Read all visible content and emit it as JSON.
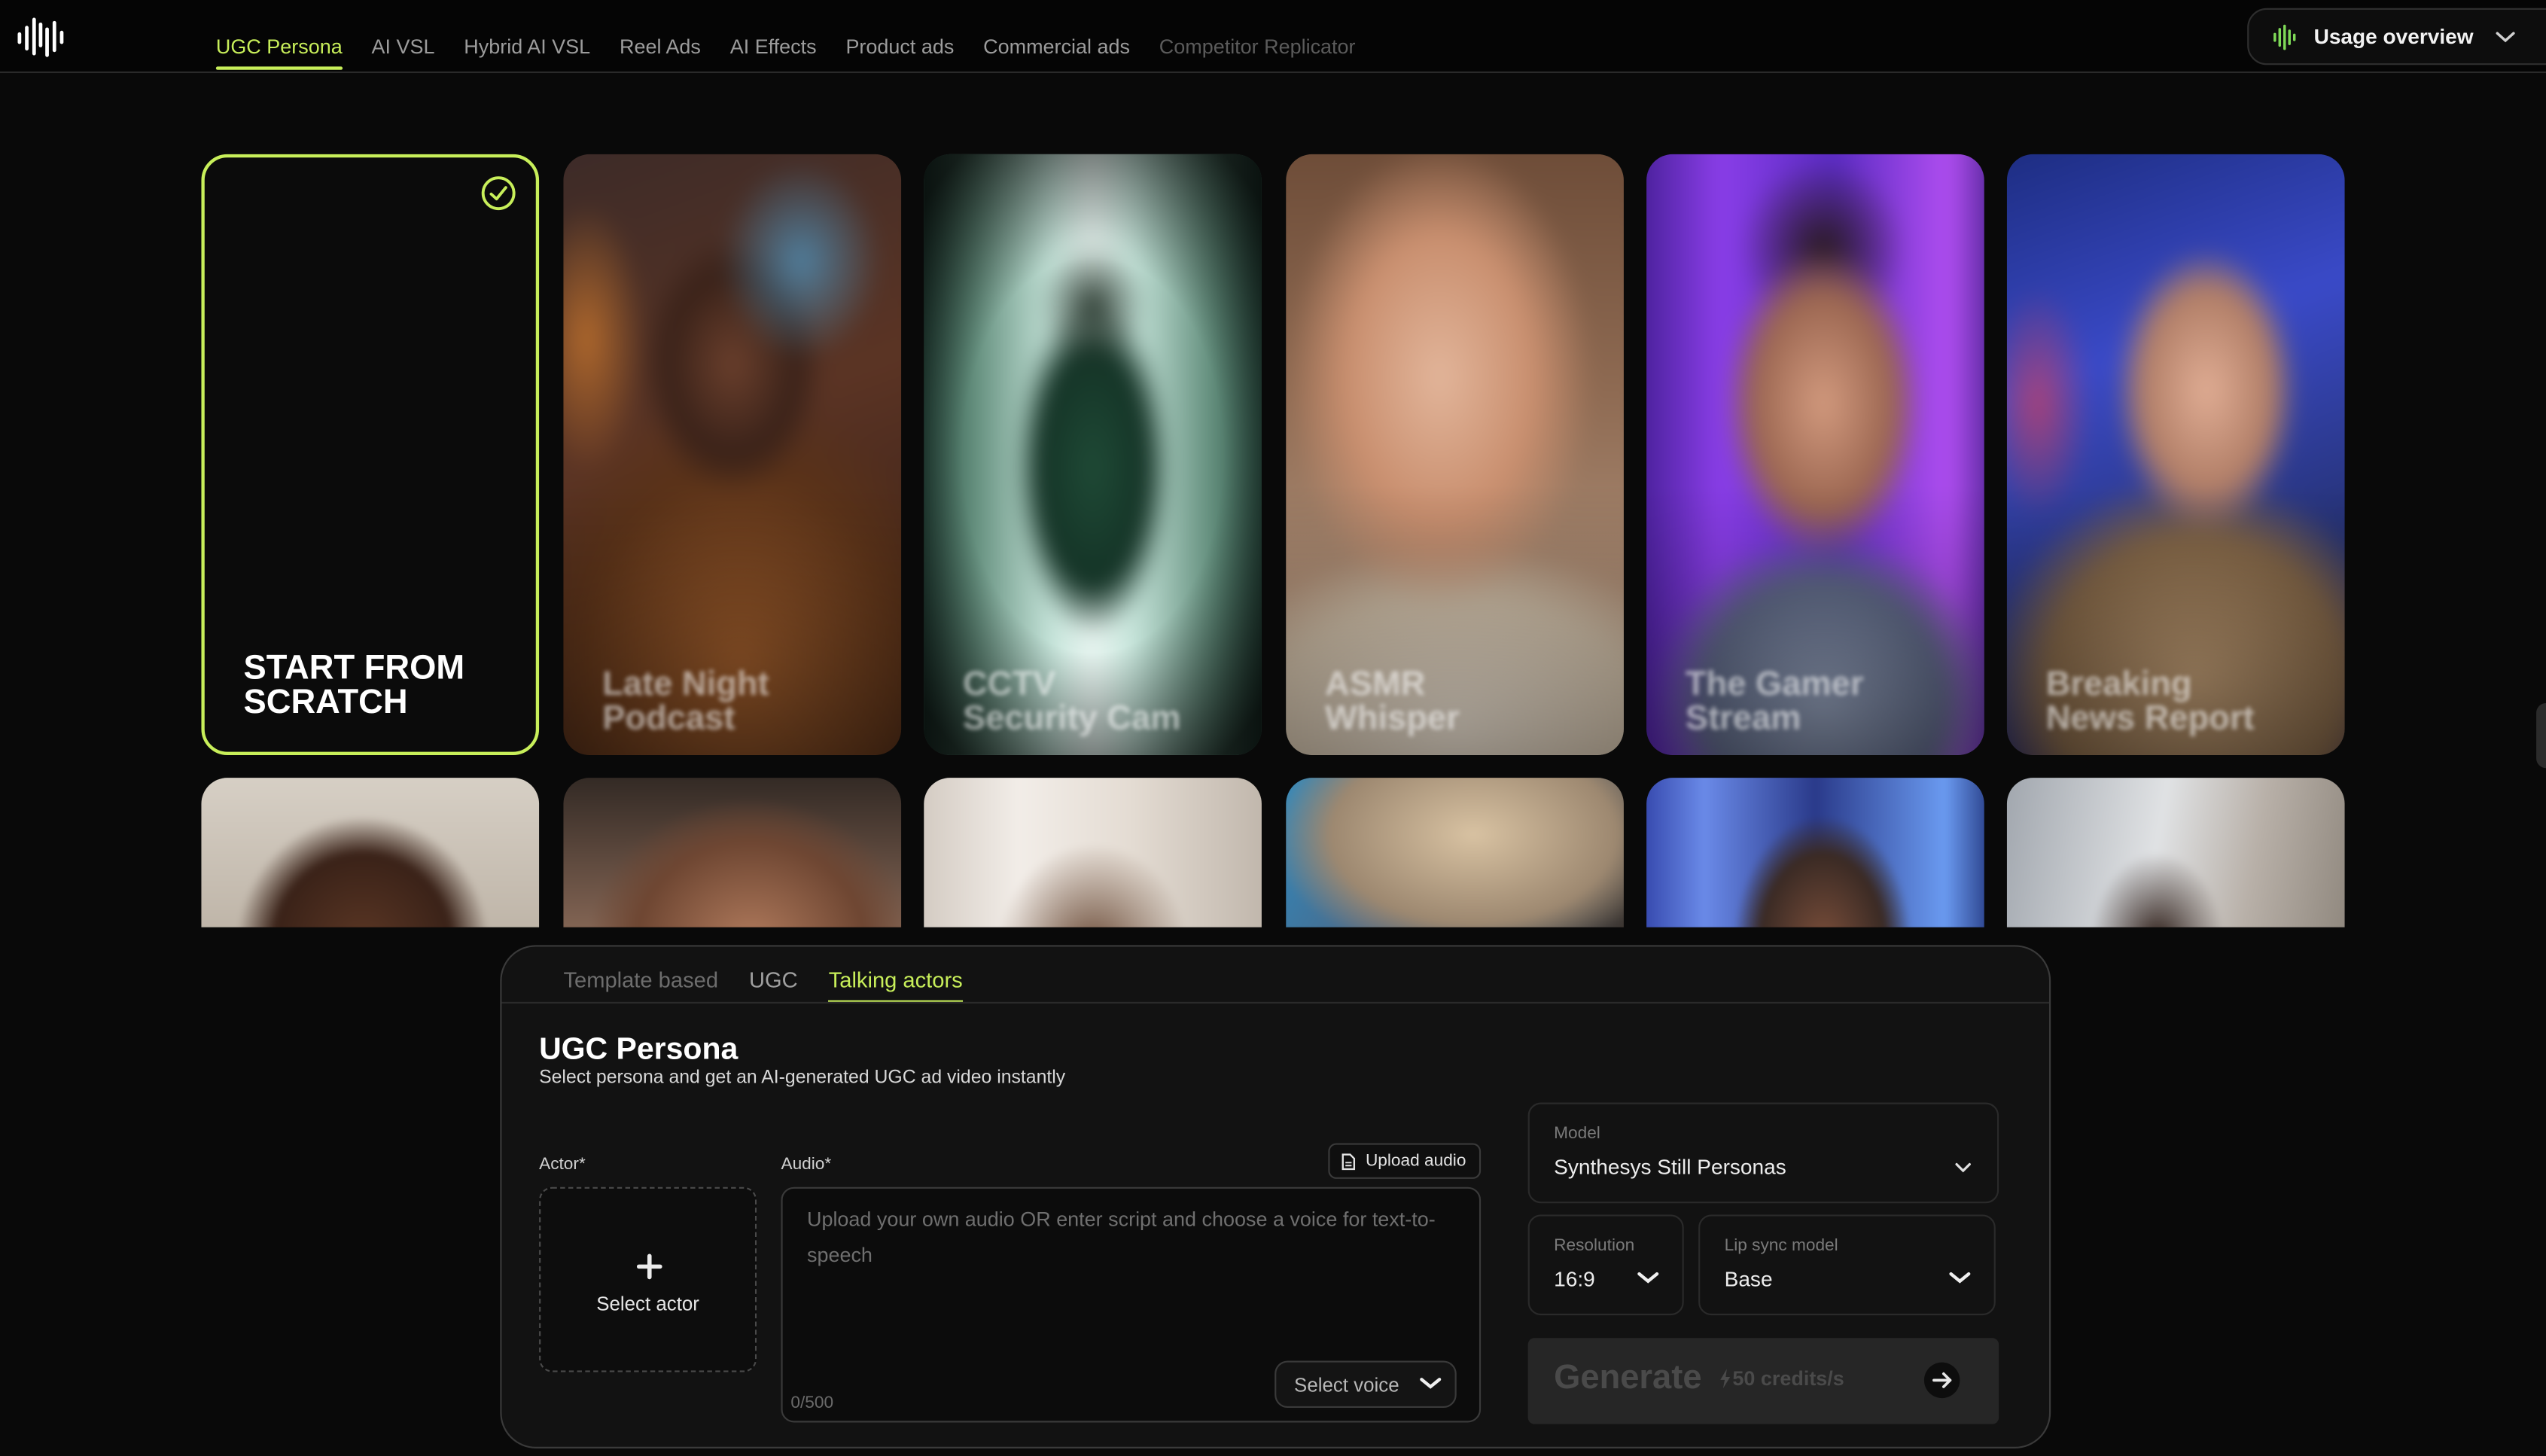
{
  "colors": {
    "accent": "#c8ef5a",
    "background": "#090909",
    "panel": "#121212"
  },
  "topbar": {
    "logo_icon": "waveform-logo-icon",
    "nav": [
      {
        "label": "UGC Persona",
        "state": "active"
      },
      {
        "label": "AI VSL",
        "state": "normal"
      },
      {
        "label": "Hybrid AI VSL",
        "state": "normal"
      },
      {
        "label": "Reel Ads",
        "state": "normal"
      },
      {
        "label": "AI Effects",
        "state": "normal"
      },
      {
        "label": "Product ads",
        "state": "normal"
      },
      {
        "label": "Commercial ads",
        "state": "normal"
      },
      {
        "label": "Competitor Replicator",
        "state": "disabled"
      }
    ],
    "usage": {
      "icon": "waveform-icon",
      "label": "Usage overview"
    }
  },
  "gallery": {
    "scratch_card": {
      "title": "START FROM\nSCRATCH",
      "selected": true
    },
    "templates": [
      {
        "title": "Late Night\nPodcast"
      },
      {
        "title": "CCTV\nSecurity Cam"
      },
      {
        "title": "ASMR\nWhisper"
      },
      {
        "title": "The Gamer\nStream"
      },
      {
        "title": "Breaking\nNews Report"
      }
    ]
  },
  "panel": {
    "tabs": [
      {
        "label": "Template based",
        "state": "dim"
      },
      {
        "label": "UGC",
        "state": "normal"
      },
      {
        "label": "Talking actors",
        "state": "active"
      }
    ],
    "title": "UGC Persona",
    "subtitle": "Select persona and get an AI-generated UGC ad video instantly",
    "actor": {
      "label": "Actor*",
      "button": "Select actor"
    },
    "audio": {
      "label": "Audio*",
      "upload_button": "Upload audio",
      "placeholder": "Upload your own audio OR enter script and choose a voice for text-to-speech",
      "counter": "0/500",
      "voice_select": "Select voice"
    },
    "model": {
      "caption": "Model",
      "value": "Synthesys Still Personas"
    },
    "resolution": {
      "caption": "Resolution",
      "value": "16:9"
    },
    "lip_sync": {
      "caption": "Lip sync model",
      "value": "Base"
    },
    "generate": {
      "label": "Generate",
      "credits": "50 credits/s"
    }
  }
}
